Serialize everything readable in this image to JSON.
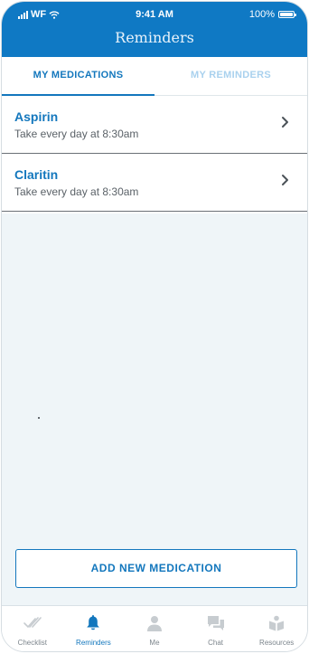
{
  "status_bar": {
    "carrier": "WF",
    "time": "9:41 AM",
    "battery": "100%",
    "battery_level": 1.0
  },
  "header": {
    "title": "Reminders"
  },
  "tabs": [
    {
      "label": "MY MEDICATIONS",
      "active": true
    },
    {
      "label": "MY REMINDERS",
      "active": false
    }
  ],
  "medications": [
    {
      "name": "Aspirin",
      "schedule": "Take every day at 8:30am"
    },
    {
      "name": "Claritin",
      "schedule": "Take every day at 8:30am"
    }
  ],
  "add_button": {
    "label": "ADD NEW MEDICATION"
  },
  "bottom_nav": [
    {
      "label": "Checklist",
      "icon": "double-check-icon",
      "active": false
    },
    {
      "label": "Reminders",
      "icon": "bell-icon",
      "active": true
    },
    {
      "label": "Me",
      "icon": "person-icon",
      "active": false
    },
    {
      "label": "Chat",
      "icon": "chat-bubbles-icon",
      "active": false
    },
    {
      "label": "Resources",
      "icon": "book-reader-icon",
      "active": false
    }
  ],
  "colors": {
    "primary": "#0f79c4",
    "accent_text": "#1377bd",
    "inactive_tab": "#a9d1ee",
    "content_bg": "#eff5f8",
    "icon_gray": "#c7ccd0"
  }
}
